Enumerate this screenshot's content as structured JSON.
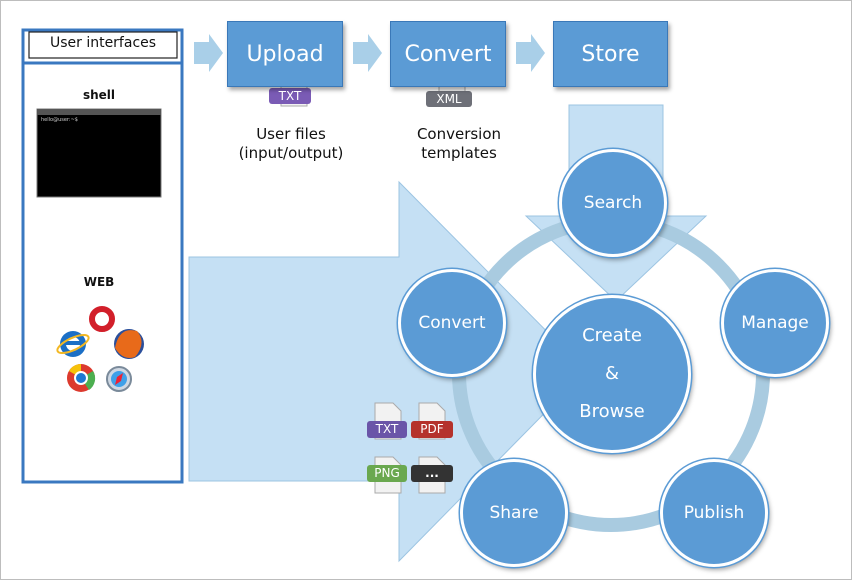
{
  "left_panel": {
    "title": "User interfaces",
    "shell_label": "shell",
    "web_label": "WEB",
    "terminal_text": "hello@user:~$"
  },
  "pipeline": {
    "upload": "Upload",
    "convert": "Convert",
    "store": "Store",
    "txt_badge": "TXT",
    "xml_badge": "XML",
    "user_files_line1": "User files",
    "user_files_line2": "(input/output)",
    "templates_line1": "Conversion",
    "templates_line2": "templates"
  },
  "cycle": {
    "center_line1": "Create",
    "center_line2": "&",
    "center_line3": "Browse",
    "search": "Search",
    "manage": "Manage",
    "publish": "Publish",
    "share": "Share",
    "convert": "Convert"
  },
  "formats": {
    "txt": "TXT",
    "pdf": "PDF",
    "png": "PNG",
    "more": "..."
  },
  "colors": {
    "accent": "#5b9bd5",
    "arrow_fill": "#c5e0f4",
    "ring": "#a9cbe0",
    "panel_border": "#3a78c0"
  }
}
